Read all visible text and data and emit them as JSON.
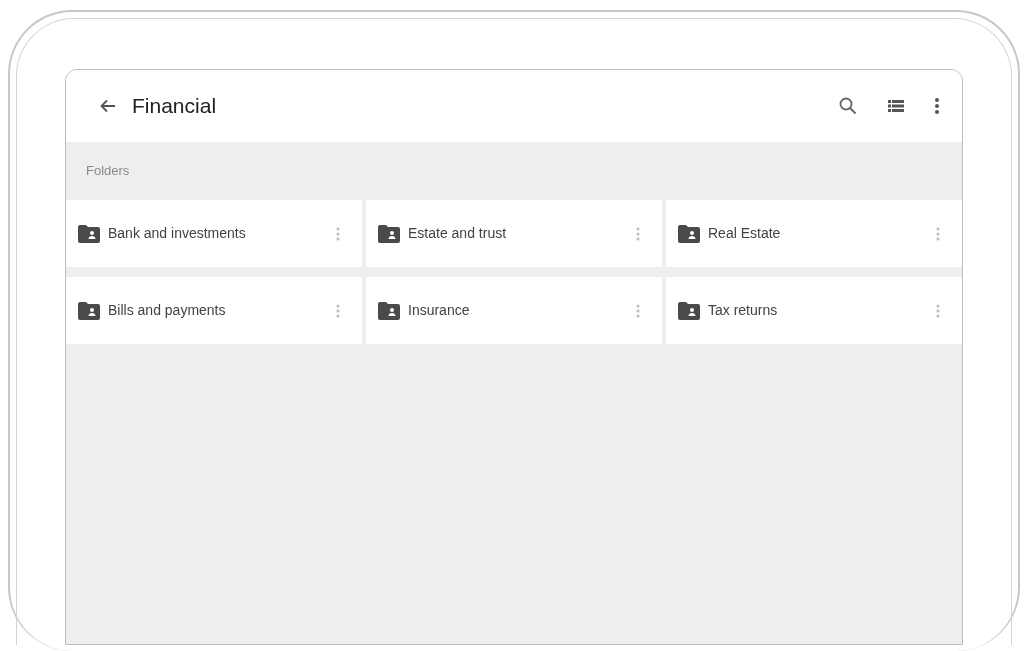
{
  "app_bar": {
    "title": "Financial"
  },
  "section_label": "Folders",
  "folders": [
    {
      "name": "Bank and investments"
    },
    {
      "name": "Estate and trust"
    },
    {
      "name": "Real Estate"
    },
    {
      "name": "Bills and payments"
    },
    {
      "name": "Insurance"
    },
    {
      "name": "Tax returns"
    }
  ]
}
